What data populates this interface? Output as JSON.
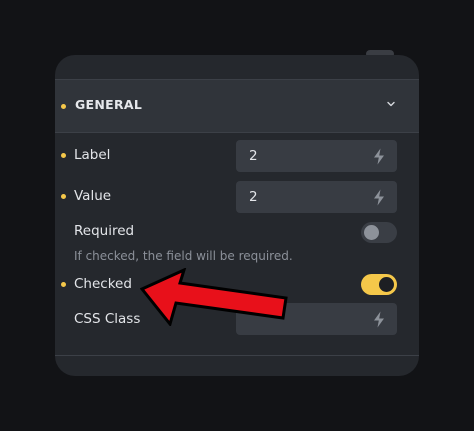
{
  "section": {
    "title": "GENERAL"
  },
  "fields": {
    "label": {
      "name": "Label",
      "value": "2"
    },
    "value": {
      "name": "Value",
      "value": "2"
    },
    "required": {
      "name": "Required",
      "hint": "If checked, the field will be required.",
      "checked": false
    },
    "checked": {
      "name": "Checked",
      "checked": true
    },
    "css_class": {
      "name": "CSS Class",
      "value": ""
    }
  },
  "icons": {
    "expand": "chevron-down-icon",
    "dynamic": "lightning-bolt-icon"
  },
  "colors": {
    "accent": "#f5c84a",
    "annotation_arrow": "#e8101a"
  }
}
